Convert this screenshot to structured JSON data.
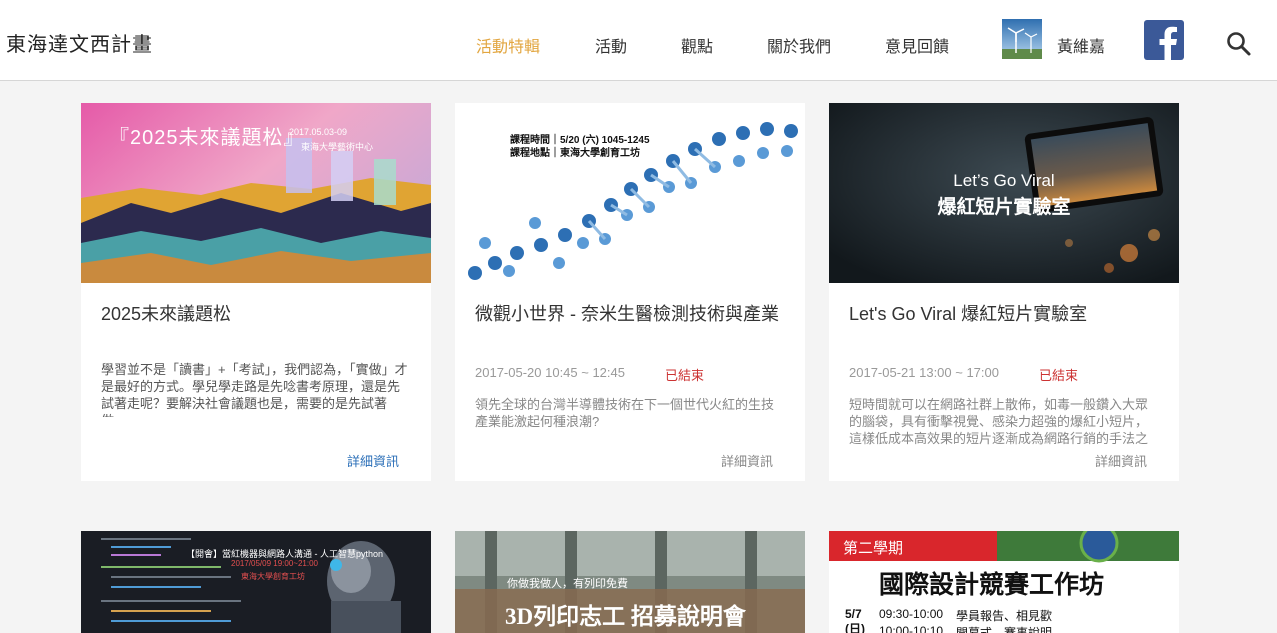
{
  "site": {
    "title": "東海達文西計畫"
  },
  "nav": {
    "items": [
      {
        "label": "活動特輯"
      },
      {
        "label": "活動"
      },
      {
        "label": "觀點"
      },
      {
        "label": "關於我們"
      },
      {
        "label": "意見回饋"
      }
    ],
    "user_name": "黃維嘉"
  },
  "colors": {
    "accent": "#e2a640",
    "facebook": "#3b5998",
    "ended": "#cc3333",
    "link": "#2b6fb8"
  },
  "cards": [
    {
      "title": "2025未來議題松",
      "description": "學習並不是「讀書」+「考試」，我們認為，「實做」才是最好的方式。學兒學走路是先唸書考原理，還是先試著走呢？要解決社會議題也是，需要的是先試著做，",
      "more": "詳細資訊",
      "image_text": {
        "title": "『2025未來議題松』",
        "sub": "2017.05.03-09",
        "venue": "東海大學藝術中心"
      }
    },
    {
      "title": "微觀小世界 - 奈米生醫檢測技術與產業",
      "datetime": "2017-05-20 10:45 ~ 12:45",
      "status": "已結束",
      "description": "領先全球的台灣半導體技術在下一個世代火紅的生技產業能激起何種浪潮?",
      "more": "詳細資訊",
      "image_text": {
        "line1": "課程時間｜5/20 (六) 1045-1245",
        "line2": "課程地點｜東海大學創育工坊"
      }
    },
    {
      "title": "Let's Go Viral 爆紅短片實驗室",
      "datetime": "2017-05-21 13:00 ~ 17:00",
      "status": "已結束",
      "description": "短時間就可以在網路社群上散佈，如毒一般鑽入大眾的腦袋，具有衝擊視覺、感染力超強的爆紅小短片，這樣低成本高效果的短片逐漸成為網路行銷的手法之一。",
      "more": "詳細資訊",
      "image_text": {
        "line1": "Let’s Go Viral",
        "line2": "爆紅短片實驗室"
      }
    },
    {
      "image_text": {
        "line1": "【開會】當紅機器與網路人溝通 - 人工智慧python",
        "line2": "2017/05/09 19:00~21:00",
        "line3": "東海大學創育工坊"
      }
    },
    {
      "image_text": {
        "line1": "你做我做人，有列印免費",
        "line2": "3D列印志工 招募說明會"
      }
    },
    {
      "image_text": {
        "tag": "第二學期",
        "title": "國際設計競賽工作坊",
        "date": "5/7",
        "day": "(日)",
        "time1": "09:30-10:00",
        "event1": "學員報告、相見歡",
        "time2": "10:00-10:10",
        "event2": "開幕式、賽事說明"
      }
    }
  ]
}
